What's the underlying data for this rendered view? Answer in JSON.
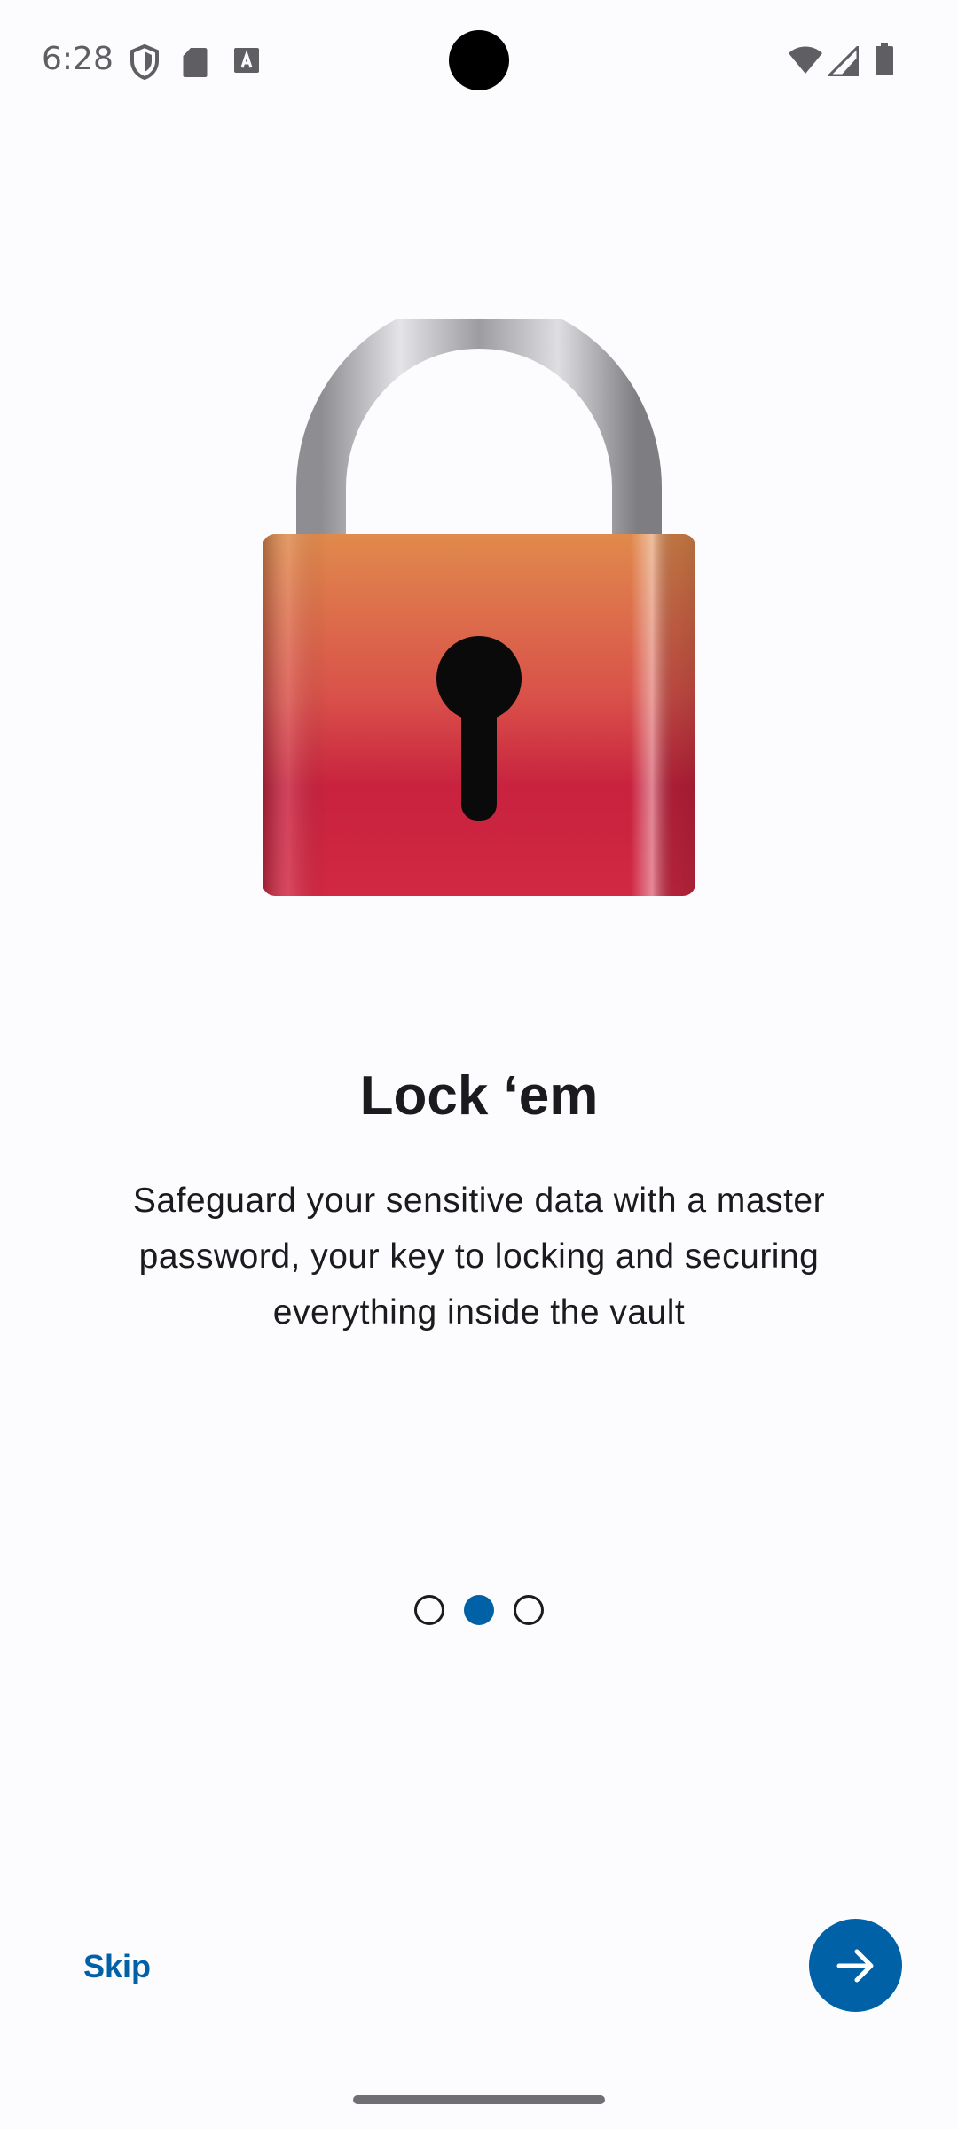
{
  "status_bar": {
    "time": "6:28",
    "left_icons": [
      "shield-icon",
      "sd-card-icon",
      "font-download-icon"
    ],
    "right_icons": [
      "wifi-icon",
      "cellular-signal-icon",
      "battery-icon"
    ]
  },
  "illustration": {
    "name": "padlock-illustration",
    "colors": {
      "body_top": "#e08a4c",
      "body_bottom": "#c8213d",
      "shackle": "#b9b9bd",
      "keyhole": "#0a0a0a"
    }
  },
  "onboarding": {
    "title": "Lock ‘em",
    "description": "Safeguard your sensitive data with a master password, your key to locking and securing everything inside the vault",
    "page_count": 3,
    "current_page": 2
  },
  "actions": {
    "skip_label": "Skip",
    "next_icon": "arrow-forward-icon"
  },
  "colors": {
    "accent": "#0061a6",
    "background": "#fcfbfe",
    "text": "#1b1b1f"
  }
}
